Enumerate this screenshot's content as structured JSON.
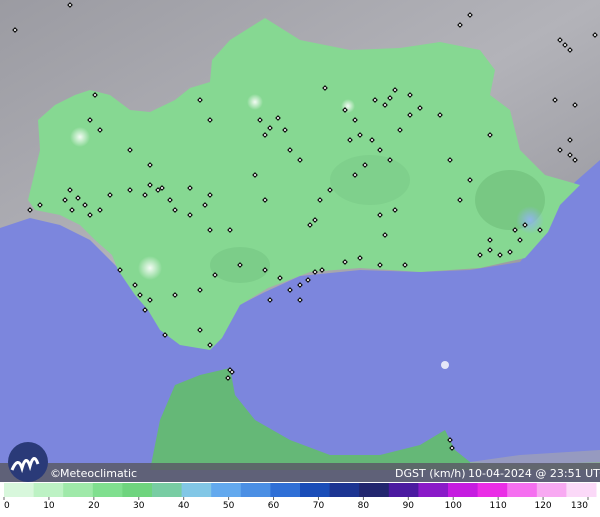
{
  "brand": {
    "name": "Meteoclimatic",
    "copyright_symbol": "©",
    "logo_icon": "meteoclimatic-logo-icon"
  },
  "status": {
    "variable": "DGST (km/h)",
    "datetime": "10-04-2024 @ 23:51 UTC"
  },
  "legend": {
    "ticks": [
      "0",
      "10",
      "20",
      "30",
      "40",
      "50",
      "60",
      "70",
      "80",
      "90",
      "100",
      "110",
      "120",
      "130"
    ],
    "min": 0,
    "max": 130,
    "colors": [
      "#d8f7dc",
      "#bdf2c4",
      "#9cea a6",
      "#7fe08e",
      "#6fd47d",
      "#7fcfa0",
      "#82c7e6",
      "#63a9ee",
      "#4a8fe4",
      "#2f6fd6",
      "#1a4db8",
      "#1d3592",
      "#22266e",
      "#4b1aa0",
      "#8a1ac8",
      "#c51ce0",
      "#ea2de6",
      "#f56ff0",
      "#f8a9f2",
      "#fbd9f8"
    ]
  },
  "map": {
    "region": "Andalucía",
    "colors": {
      "sea": "#7c86dd",
      "land_outside": "#a8a8ae",
      "region": "#86d892",
      "morocco": "#65b877",
      "station": "#000000"
    }
  }
}
